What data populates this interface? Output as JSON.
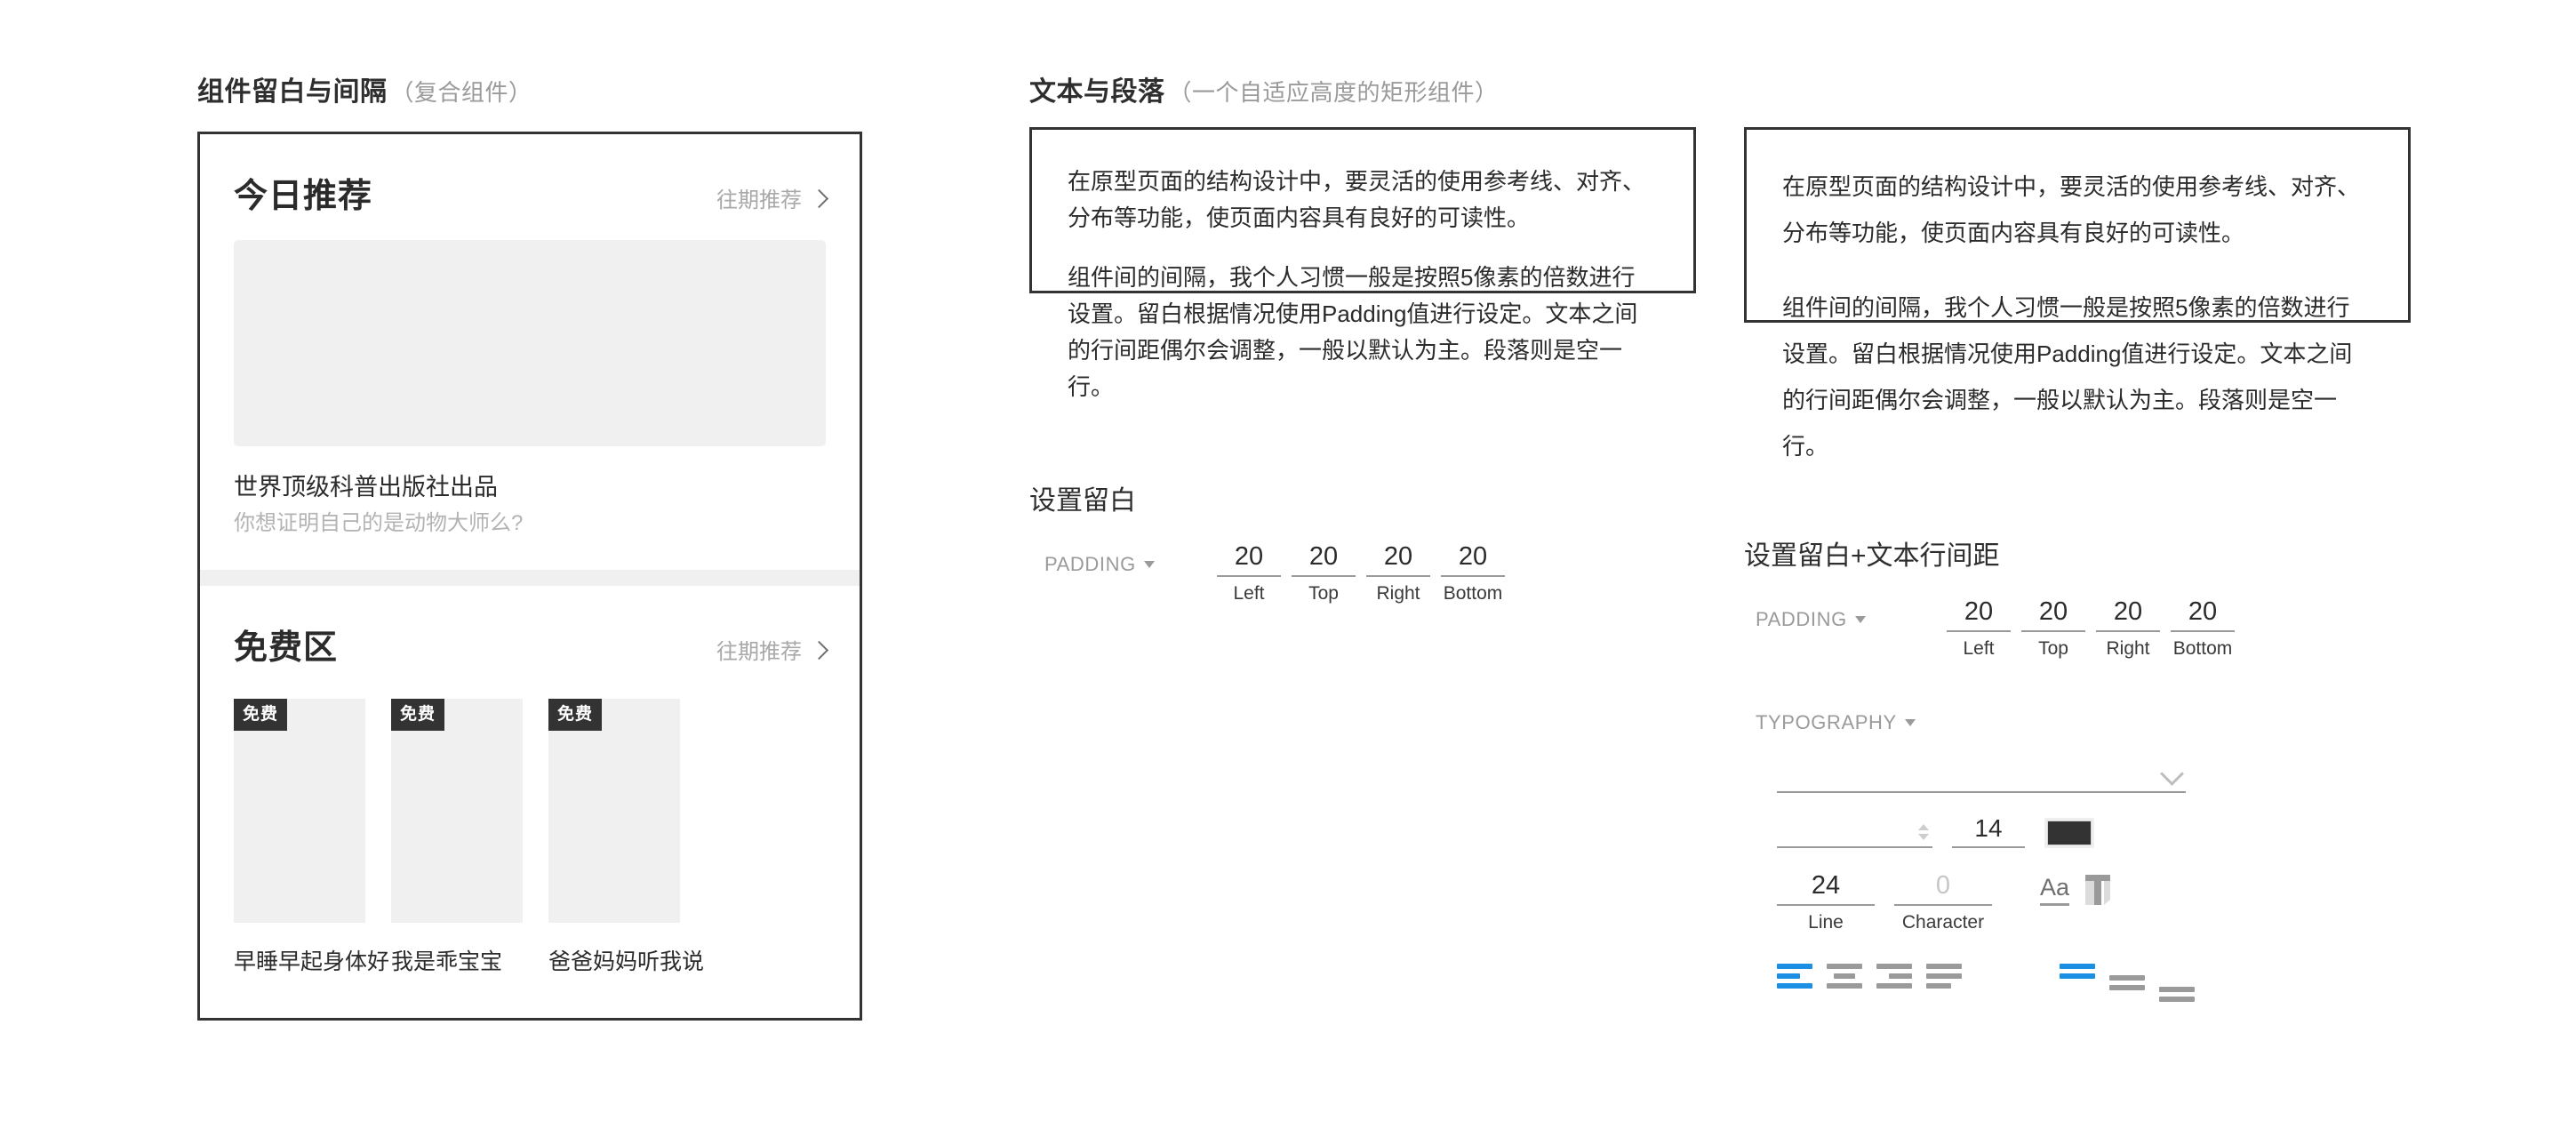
{
  "sections": {
    "left": {
      "title": "组件留白与间隔",
      "subtitle": "（复合组件）"
    },
    "mid": {
      "title": "文本与段落",
      "subtitle": "（一个自适应高度的矩形组件）"
    },
    "mid_padding_title": "设置留白",
    "right_padding_title": "设置留白+文本行间距"
  },
  "phone": {
    "today": {
      "heading": "今日推荐",
      "more_label": "往期推荐",
      "caption_title": "世界顶级科普出版社出品",
      "caption_sub": "你想证明自己的是动物大师么?"
    },
    "free": {
      "heading": "免费区",
      "more_label": "往期推荐",
      "badge": "免费",
      "items": [
        {
          "badge": "免费",
          "name": "早睡早起身体好"
        },
        {
          "badge": "免费",
          "name": "我是乖宝宝"
        },
        {
          "badge": "免费",
          "name": "爸爸妈妈听我说"
        }
      ]
    }
  },
  "paragraphs": {
    "p1": "在原型页面的结构设计中，要灵活的使用参考线、对齐、分布等功能，使页面内容具有良好的可读性。",
    "p2": "组件间的间隔，我个人习惯一般是按照5像素的倍数进行设置。留白根据情况使用Padding值进行设定。文本之间的行间距偶尔会调整，一般以默认为主。段落则是空一行。"
  },
  "padding_widget": {
    "label": "PADDING",
    "fields": [
      {
        "value": "20",
        "caption": "Left"
      },
      {
        "value": "20",
        "caption": "Top"
      },
      {
        "value": "20",
        "caption": "Right"
      },
      {
        "value": "20",
        "caption": "Bottom"
      }
    ]
  },
  "typography_widget": {
    "label": "TYPOGRAPHY",
    "font_family": "",
    "font_size": "14",
    "color_hex": "#333333",
    "line_spacing": {
      "value": "24",
      "caption": "Line"
    },
    "character_spacing": {
      "value": "0",
      "caption": "Character"
    },
    "case_button": "Aa",
    "align_horizontal": {
      "options": [
        "align-left",
        "align-center",
        "align-right",
        "align-justify"
      ],
      "selected": "align-left"
    },
    "align_vertical": {
      "options": [
        "valign-top",
        "valign-middle",
        "valign-bottom"
      ],
      "selected": "valign-top"
    },
    "accent_color": "#1a8fe3"
  }
}
